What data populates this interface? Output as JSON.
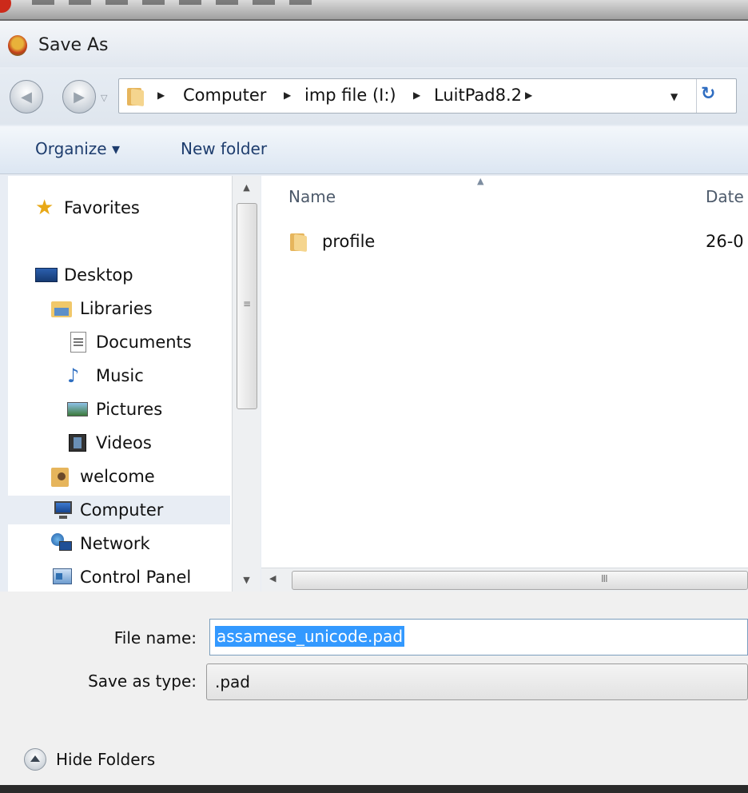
{
  "window": {
    "title": "Save As"
  },
  "address": {
    "crumbs": [
      "Computer",
      "imp file (I:)",
      "LuitPad8.2"
    ]
  },
  "toolbar": {
    "organize_label": "Organize ▾",
    "new_folder_label": "New folder"
  },
  "nav": {
    "favorites": "Favorites",
    "desktop": "Desktop",
    "libraries": "Libraries",
    "documents": "Documents",
    "music": "Music",
    "pictures": "Pictures",
    "videos": "Videos",
    "welcome": "welcome",
    "computer": "Computer",
    "network": "Network",
    "control_panel": "Control Panel"
  },
  "columns": {
    "name": "Name",
    "date": "Date"
  },
  "files": [
    {
      "name": "profile",
      "date": "26-0"
    }
  ],
  "form": {
    "file_name_label": "File name:",
    "file_name_value": "assamese_unicode.pad",
    "save_type_label": "Save as type:",
    "save_type_value": ".pad"
  },
  "hide_folders_label": "Hide Folders",
  "colors": {
    "selection": "#3399ff",
    "toolbar_text": "#1e3d6e",
    "selected_row": "#e8edf4"
  },
  "icons": [
    "app-icon",
    "back-arrow-icon",
    "forward-arrow-icon",
    "folder-icon",
    "refresh-icon",
    "star-icon",
    "desktop-icon",
    "libraries-icon",
    "document-icon",
    "music-icon",
    "pictures-icon",
    "videos-icon",
    "user-icon",
    "computer-icon",
    "network-icon",
    "control-panel-icon",
    "chevron-up-icon"
  ]
}
